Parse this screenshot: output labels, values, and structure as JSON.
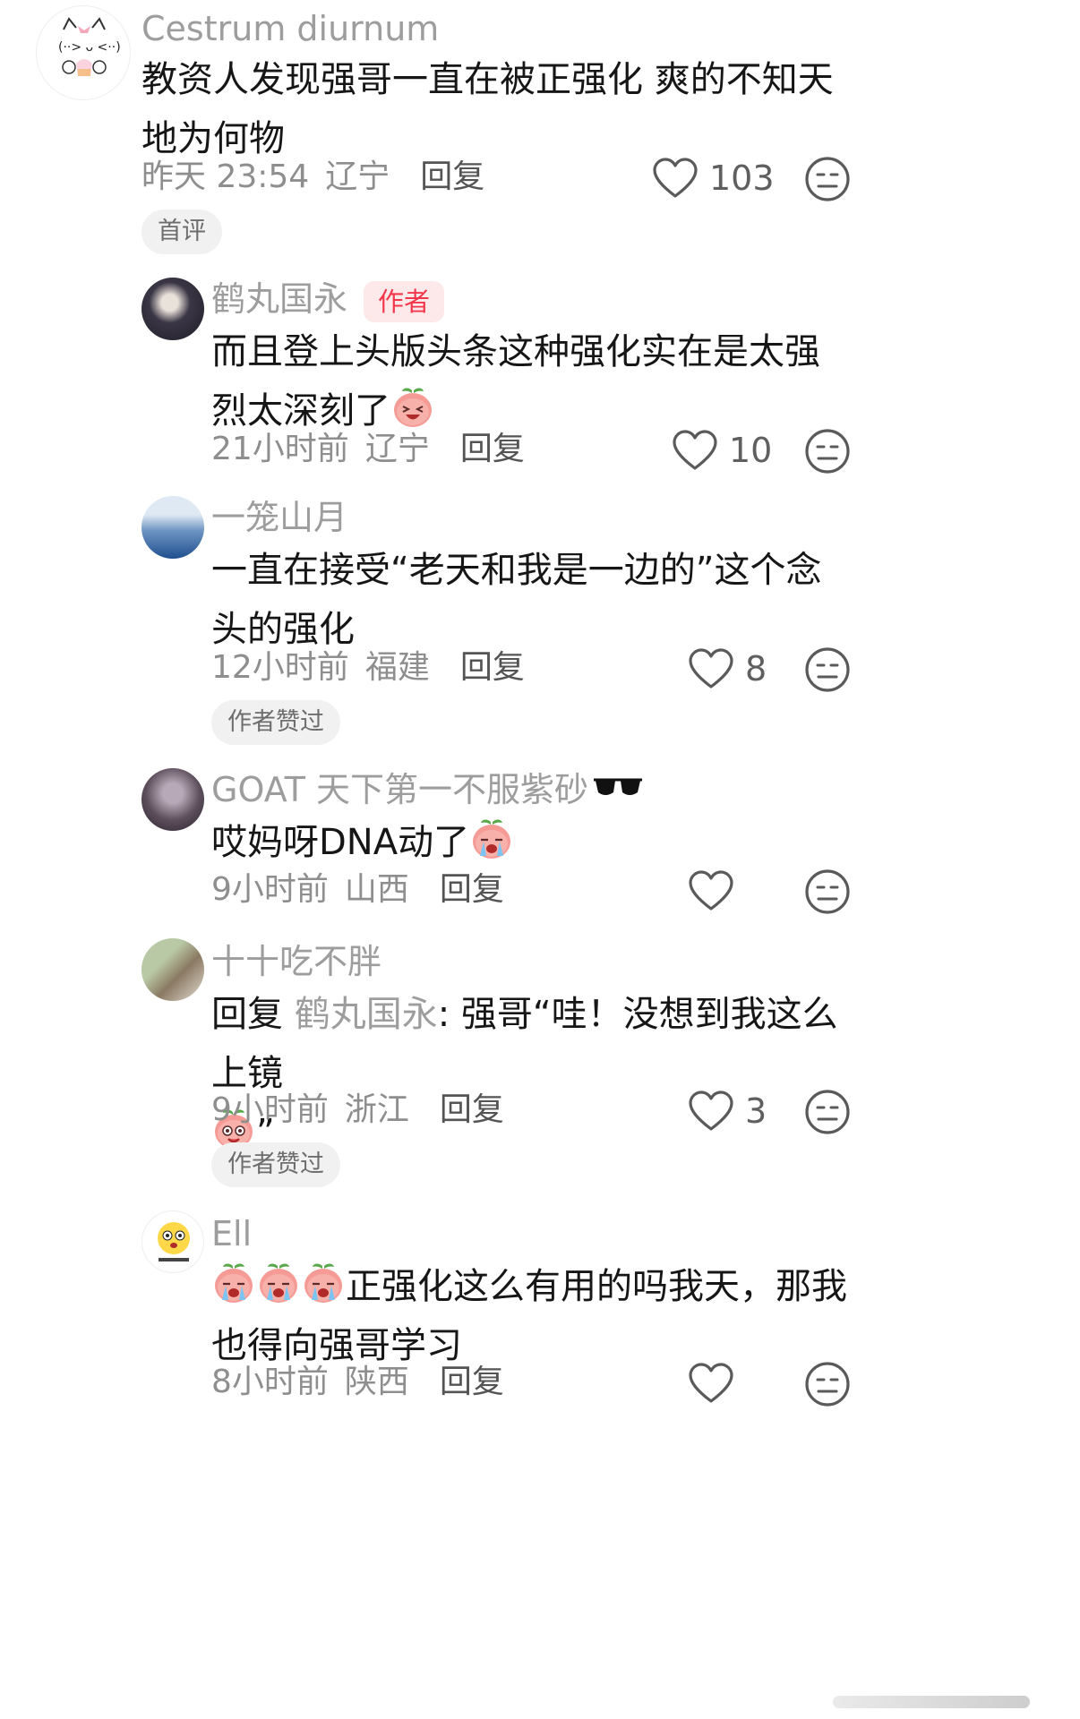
{
  "comments": [
    {
      "username": "Cestrum diurnum",
      "text": "教资人发现强哥一直在被正强化 爽的不知天地为何物",
      "time": "昨天 23:54",
      "location": "辽宁",
      "reply_label": "回复",
      "likes": "103",
      "badge": "首评",
      "avatar_icon": "cat-cupcake-avatar"
    },
    {
      "username": "鹤丸国永",
      "author_tag": "作者",
      "text": "而且登上头版头条这种强化实在是太强烈太深刻了",
      "time": "21小时前",
      "location": "辽宁",
      "reply_label": "回复",
      "likes": "10",
      "emoji": "laughing-peach-emoji"
    },
    {
      "username": "一笼山月",
      "text": "一直在接受“老天和我是一边的”这个念头的强化",
      "time": "12小时前",
      "location": "福建",
      "reply_label": "回复",
      "likes": "8",
      "badge": "作者赞过"
    },
    {
      "username": "GOAT 天下第一不服紫砂",
      "text": "哎妈呀DNA动了",
      "time": "9小时前",
      "location": "山西",
      "reply_label": "回复",
      "likes": "",
      "emoji": "crying-peach-emoji",
      "name_emoji": "sunglasses-emoji"
    },
    {
      "username": "十十吃不胖",
      "reply_prefix": "回复",
      "mention": "鹤丸国永",
      "text": ": 强哥“哇！没想到我这么上镜",
      "text_tail": "”",
      "time": "9小时前",
      "location": "浙江",
      "reply_label": "回复",
      "likes": "3",
      "badge": "作者赞过",
      "emoji": "drooling-peach-emoji"
    },
    {
      "username": "Ell",
      "text": "正强化这么有用的吗我天，那我也得向强哥学习",
      "time": "8小时前",
      "location": "陕西",
      "reply_label": "回复",
      "likes": "",
      "emoji": "crying-peach-emoji"
    }
  ],
  "colors": {
    "username": "#9d9d9d",
    "body_text": "#161616",
    "author_tag_bg": "#fde8ea",
    "author_tag_text": "#f2374b",
    "badge_bg": "#f1f1f1"
  }
}
